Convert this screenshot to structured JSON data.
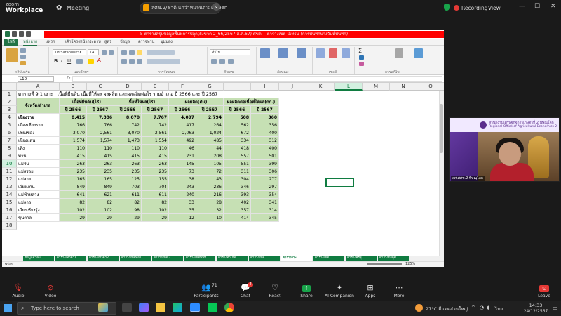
{
  "zoom": {
    "brand_line1": "zoom",
    "brand_line2": "Workplace",
    "meeting_label": "Meeting",
    "share_text": "สศข.2/ชาติ แกว่าหมจนด's screen",
    "recording_label": "Recording",
    "view_label": "View",
    "toolbar": [
      {
        "label": "Audio",
        "icon": "microphone-icon"
      },
      {
        "label": "Video",
        "icon": "video-icon"
      },
      {
        "label": "Participants",
        "icon": "participants-icon",
        "count": "71"
      },
      {
        "label": "Chat",
        "icon": "chat-icon",
        "badge": "4"
      },
      {
        "label": "React",
        "icon": "react-icon"
      },
      {
        "label": "Share",
        "icon": "share-icon"
      },
      {
        "label": "AI Companion",
        "icon": "ai-companion-icon"
      },
      {
        "label": "Apps",
        "icon": "apps-icon"
      },
      {
        "label": "More",
        "icon": "more-icon"
      },
      {
        "label": "Leave",
        "icon": "leave-icon"
      }
    ]
  },
  "excel": {
    "title": "5 ตารางสรุปข้อมูลพื้นที่การปลูก(ยังขาด 2_66/2567 ส.ค.67) ศขด. - ตารางเขต-ปีเทรน (การบันทึกบางวันที่บันทึก)",
    "ribbon_tabs": [
      "ไฟล์",
      "หน้าแรก",
      "แทรก",
      "เค้าโครงหน้ากระดาษ",
      "สูตร",
      "ข้อมูล",
      "ตรวจทาน",
      "มุมมอง"
    ],
    "ribbon_groups": [
      "คลิปบอร์ด",
      "แบบอักษร",
      "การจัดแนว",
      "ตัวเลข",
      "ลักษณะ",
      "เซลล์",
      "การแก้ไข"
    ],
    "font_name": "TH SarabunPSK",
    "font_size": "14",
    "number_format": "ทั่วไป",
    "name_box": "L10",
    "fx": "fx",
    "columns": [
      "A",
      "B",
      "C",
      "D",
      "E",
      "F",
      "G",
      "H",
      "I",
      "J",
      "K",
      "L",
      "M",
      "N",
      "O"
    ],
    "selected_col": "L",
    "selected_row": "10",
    "table_title": "ตารางที่ 9.1 เงาะ : เนื้อที่ยืนต้น เนื้อที่ให้ผล ผลผลิต และผลผลิตต่อไร่ รายอำเภอ  ปี 2566 และ ปี 2567",
    "headers": {
      "district": "จังหวัด/อำเภอ",
      "groups": [
        "เนื้อที่ยืนต้น(ไร่)",
        "เนื้อที่ให้ผล(ไร่)",
        "ผลผลิต(ตัน)",
        "ผลผลิตต่อเนื้อที่ให้ผล(กก.)"
      ],
      "years": [
        "ปี 2566",
        "ปี 2567"
      ]
    },
    "rows": [
      {
        "row": "4",
        "name": "เชียงราย",
        "vals": [
          "8,415",
          "7,886",
          "8,070",
          "7,767",
          "4,097",
          "2,794",
          "508",
          "360"
        ],
        "total": true
      },
      {
        "row": "5",
        "name": "เมืองเชียงราย",
        "vals": [
          "766",
          "766",
          "742",
          "742",
          "417",
          "264",
          "562",
          "356"
        ]
      },
      {
        "row": "6",
        "name": "เชียงของ",
        "vals": [
          "3,070",
          "2,561",
          "3,070",
          "2,561",
          "2,063",
          "1,024",
          "672",
          "400"
        ]
      },
      {
        "row": "7",
        "name": "เชียงแสน",
        "vals": [
          "1,574",
          "1,574",
          "1,473",
          "1,554",
          "492",
          "485",
          "334",
          "312"
        ]
      },
      {
        "row": "8",
        "name": "เทิง",
        "vals": [
          "110",
          "110",
          "110",
          "110",
          "46",
          "44",
          "418",
          "400"
        ]
      },
      {
        "row": "9",
        "name": "พาน",
        "vals": [
          "415",
          "415",
          "415",
          "415",
          "231",
          "208",
          "557",
          "501"
        ]
      },
      {
        "row": "10",
        "name": "แม่จัน",
        "vals": [
          "263",
          "263",
          "263",
          "263",
          "145",
          "105",
          "551",
          "399"
        ]
      },
      {
        "row": "11",
        "name": "แม่สรวย",
        "vals": [
          "235",
          "235",
          "235",
          "235",
          "73",
          "72",
          "311",
          "306"
        ]
      },
      {
        "row": "12",
        "name": "แม่สาย",
        "vals": [
          "165",
          "165",
          "125",
          "155",
          "38",
          "43",
          "304",
          "277"
        ]
      },
      {
        "row": "13",
        "name": "เวียงแก่น",
        "vals": [
          "849",
          "849",
          "703",
          "704",
          "243",
          "236",
          "346",
          "297"
        ]
      },
      {
        "row": "14",
        "name": "แม่ฟ้าหลวง",
        "vals": [
          "641",
          "621",
          "611",
          "611",
          "240",
          "216",
          "393",
          "354"
        ]
      },
      {
        "row": "15",
        "name": "แม่ลาว",
        "vals": [
          "82",
          "82",
          "82",
          "82",
          "33",
          "28",
          "402",
          "341"
        ]
      },
      {
        "row": "16",
        "name": "เวียงเชียงรุ้ง",
        "vals": [
          "102",
          "102",
          "98",
          "102",
          "35",
          "32",
          "357",
          "314"
        ]
      },
      {
        "row": "17",
        "name": "ขุนตาล",
        "vals": [
          "29",
          "29",
          "29",
          "29",
          "12",
          "10",
          "414",
          "345"
        ]
      }
    ],
    "sheet_tabs": [
      "ข้อมูลอ้างอิง",
      "ตารางเทวดา1",
      "ตารางเทวดา2",
      "ตารางเขตท่อ1",
      "ตารางเขต 2",
      "ตารางเขตพื้นที่",
      "ตารางอำเภอ",
      "ตารางเขต",
      "ตารางงาะ",
      "ตารางเขต",
      "ตารางศรีสุ",
      "ตารางมังคุด"
    ],
    "status": "พร้อม",
    "zoom_level": "125%"
  },
  "video": {
    "org_line1": "สำนักงานเศรษฐกิจการเกษตรที่ 2 พิษณุโลก",
    "org_line2": "Regional Office of Agricultural Economics 2",
    "participant_name": "สศ.ศศข.2 พิษณุโลก"
  },
  "taskbar": {
    "search_placeholder": "Type here to search",
    "temperature": "27°C มีแดดส่วนใหญ่",
    "lang": "ไทย",
    "time": "14:33",
    "date": "24/12/2567"
  },
  "colors": {
    "excel_green": "#217346",
    "header_green": "#c6e0b4",
    "title_red": "#ff0000",
    "recording_red": "#e53935",
    "share_green": "#18a34a"
  }
}
